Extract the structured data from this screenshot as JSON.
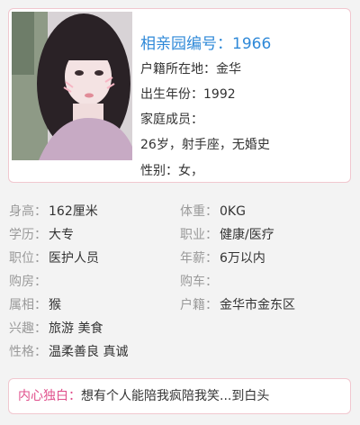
{
  "profile": {
    "title": "相亲园编号：1966",
    "lines": [
      "户籍所在地：金华",
      "出生年份：1992",
      "家庭成员：",
      "26岁，射手座，无婚史",
      "性别：女，"
    ]
  },
  "details": [
    {
      "label": "身高：",
      "value": "162厘米"
    },
    {
      "label": "体重：",
      "value": "0KG"
    },
    {
      "label": "学历：",
      "value": "大专"
    },
    {
      "label": "职业：",
      "value": "健康/医疗"
    },
    {
      "label": "职位：",
      "value": "医护人员"
    },
    {
      "label": "年薪：",
      "value": "6万以内"
    },
    {
      "label": "购房：",
      "value": ""
    },
    {
      "label": "购车：",
      "value": ""
    },
    {
      "label": "属相：",
      "value": "猴"
    },
    {
      "label": "户籍：",
      "value": "金华市金东区"
    },
    {
      "label": "兴趣：",
      "value": "旅游 美食"
    },
    {
      "label": "性格：",
      "value": "温柔善良 真诚"
    }
  ],
  "monologue": {
    "label": "内心独白：",
    "text": "想有个人能陪我疯陪我笑...到白头"
  },
  "colors": {
    "accent_blue": "#2f89d8",
    "accent_pink": "#e0508c",
    "border_pink": "#f1c7cf"
  }
}
